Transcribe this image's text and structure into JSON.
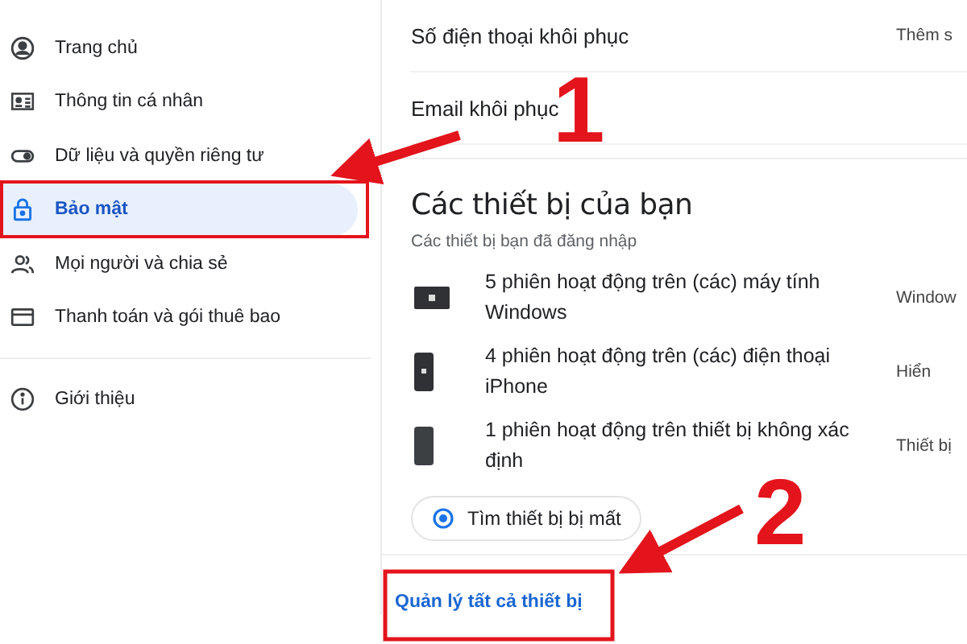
{
  "sidebar": {
    "items": [
      {
        "label": "Trang chủ",
        "kind": "home",
        "selected": false
      },
      {
        "label": "Thông tin cá nhân",
        "kind": "profile",
        "selected": false
      },
      {
        "label": "Dữ liệu và quyền riêng tư",
        "kind": "data",
        "selected": false
      },
      {
        "label": "Bảo mật",
        "kind": "security",
        "selected": true
      },
      {
        "label": "Mọi người và chia sẻ",
        "kind": "people",
        "selected": false
      },
      {
        "label": "Thanh toán và gói thuê bao",
        "kind": "payments",
        "selected": false
      }
    ],
    "footer_item": {
      "label": "Giới thiệu",
      "kind": "about"
    }
  },
  "recovery": {
    "rows": [
      {
        "label": "Số điện thoại khôi phục",
        "value": "Thêm s"
      },
      {
        "label": "Email khôi phục"
      }
    ]
  },
  "devices": {
    "title": "Các thiết bị của bạn",
    "subtitle": "Các thiết bị bạn đã đăng nhập",
    "items": [
      {
        "kind": "computer",
        "text": "5 phiên hoạt động trên (các) máy tính Windows",
        "value": "Window"
      },
      {
        "kind": "phone",
        "text": "4 phiên hoạt động trên (các) điện thoại iPhone",
        "value": "Hiển"
      },
      {
        "kind": "unknown",
        "text": "1 phiên hoạt động trên thiết bị không xác định",
        "value": "Thiết bị"
      }
    ],
    "find_button": "Tìm thiết bị bị mất",
    "manage_link": "Quản lý tất cả thiết bị"
  },
  "annotations": [
    {
      "label": "1"
    },
    {
      "label": "2"
    }
  ]
}
